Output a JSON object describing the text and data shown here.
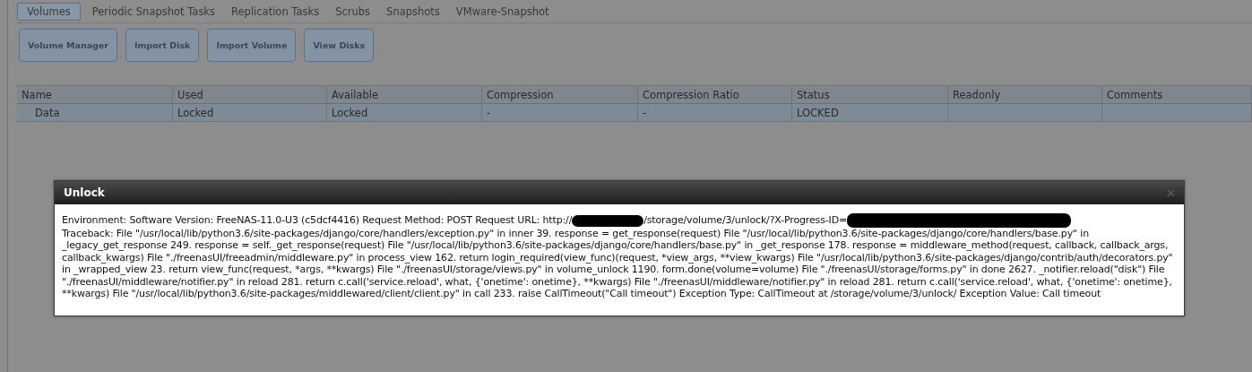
{
  "tabs": [
    {
      "label": "Volumes",
      "selected": true
    },
    {
      "label": "Periodic Snapshot Tasks",
      "selected": false
    },
    {
      "label": "Replication Tasks",
      "selected": false
    },
    {
      "label": "Scrubs",
      "selected": false
    },
    {
      "label": "Snapshots",
      "selected": false
    },
    {
      "label": "VMware-Snapshot",
      "selected": false
    }
  ],
  "buttons": [
    "Volume Manager",
    "Import Disk",
    "Import Volume",
    "View Disks"
  ],
  "table": {
    "columns": [
      "Name",
      "Used",
      "Available",
      "Compression",
      "Compression Ratio",
      "Status",
      "Readonly",
      "Comments"
    ],
    "rows": [
      {
        "selected": true,
        "cells": [
          "Data",
          "Locked",
          "Locked",
          "-",
          "-",
          "LOCKED",
          "",
          ""
        ]
      }
    ]
  },
  "dialog": {
    "title": "Unlock",
    "message": [
      {
        "kind": "text",
        "text": "Environment: Software Version: FreeNAS-11.0-U3 (c5dcf4416) Request Method: POST Request URL: http://"
      },
      {
        "kind": "redacted"
      },
      {
        "kind": "text",
        "text": "/storage/volume/3/unlock/?X-Progress-ID="
      },
      {
        "kind": "redacted"
      },
      {
        "kind": "paragraph",
        "text": "Traceback: File \"/usr/local/lib/python3.6/site-packages/django/core/handlers/exception.py\" in inner 39. response = get_response(request) File \"/usr/local/lib/python3.6/site-packages/django/core/handlers/base.py\" in _legacy_get_response 249. response = self._get_response(request) File \"/usr/local/lib/python3.6/site-packages/django/core/handlers/base.py\" in _get_response 178. response = middleware_method(request, callback, callback_args, callback_kwargs) File \"./freenasUI/freeadmin/middleware.py\" in process_view 162. return login_required(view_func)(request, *view_args, **view_kwargs) File \"/usr/local/lib/python3.6/site-packages/django/contrib/auth/decorators.py\" in _wrapped_view 23. return view_func(request, *args, **kwargs) File \"./freenasUI/storage/views.py\" in volume_unlock 1190. form.done(volume=volume) File \"./freenasUI/storage/forms.py\" in done 2627. _notifier.reload(\"disk\") File \"./freenasUI/middleware/notifier.py\" in reload 281. return c.call('service.reload', what, {'onetime': onetime}, **kwargs) File \"./freenasUI/middleware/notifier.py\" in reload 281. return c.call('service.reload', what, {'onetime': onetime}, **kwargs) File \"/usr/local/lib/python3.6/site-packages/middlewared/client/client.py\" in call 233. raise CallTimeout(\"Call timeout\") Exception Type: CallTimeout at /storage/volume/3/unlock/ Exception Value: Call timeout"
      }
    ]
  }
}
